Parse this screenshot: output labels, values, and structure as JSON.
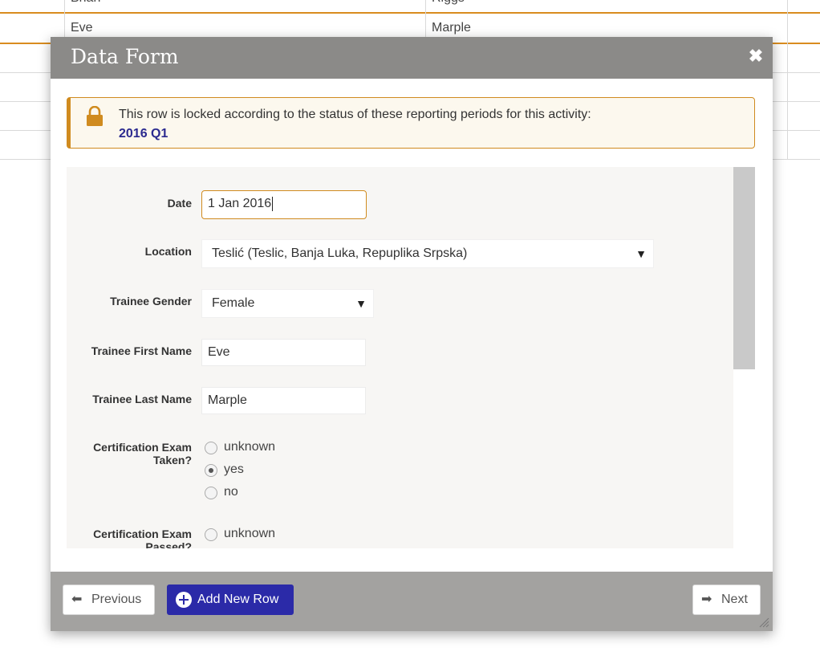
{
  "background_table": {
    "rows": [
      {
        "first": "Brian",
        "last": "Riggs"
      },
      {
        "first": "Eve",
        "last": "Marple"
      }
    ]
  },
  "dialog": {
    "title": "Data Form",
    "close_icon": "close-icon",
    "lock_message": "This row is locked according to the status of these reporting periods for this activity:",
    "lock_period": "2016 Q1",
    "fields": {
      "date_label": "Date",
      "date_value": "1 Jan 2016",
      "location_label": "Location",
      "location_value": "Teslić (Teslic, Banja Luka, Repuplika Srpska)",
      "gender_label": "Trainee Gender",
      "gender_value": "Female",
      "first_name_label": "Trainee First Name",
      "first_name_value": "Eve",
      "last_name_label": "Trainee Last Name",
      "last_name_value": "Marple",
      "exam_taken_label": "Certification Exam Taken?",
      "exam_taken_options": [
        "unknown",
        "yes",
        "no"
      ],
      "exam_taken_selected": "yes",
      "exam_passed_label": "Certification Exam Passed?",
      "exam_passed_options": [
        "unknown"
      ]
    },
    "footer": {
      "previous_label": "Previous",
      "add_row_label": "Add New Row",
      "next_label": "Next"
    }
  },
  "colors": {
    "header_bg": "#8b8a88",
    "accent_orange": "#d08b1f",
    "primary_blue": "#2b2aa8",
    "footer_bg": "#a3a2a0"
  }
}
